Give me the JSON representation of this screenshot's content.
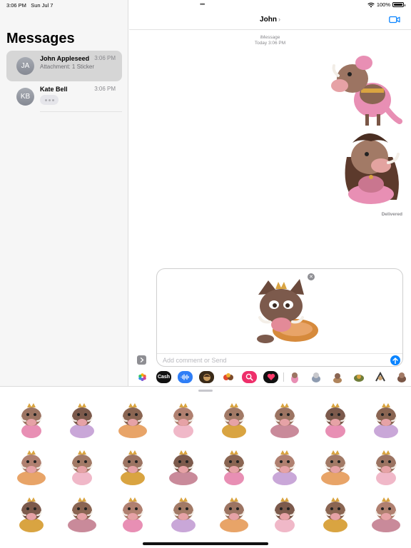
{
  "status_bar": {
    "time": "3:06 PM",
    "date": "Sun Jul 7",
    "battery": "100%"
  },
  "sidebar": {
    "title": "Messages",
    "conversations": [
      {
        "initials": "JA",
        "name": "John Appleseed",
        "time": "3:06 PM",
        "preview": "Attachment: 1 Sticker",
        "selected": true
      },
      {
        "initials": "KB",
        "name": "Kate Bell",
        "time": "3:06 PM",
        "preview": "",
        "typing": true
      }
    ]
  },
  "chat": {
    "contact_name": "John",
    "service_label": "iMessage",
    "timestamp_label": "Today 3:06 PM",
    "delivered_label": "Delivered",
    "compose_placeholder": "Add comment or Send"
  },
  "app_strip": {
    "apps": [
      {
        "name": "photos-app-icon"
      },
      {
        "name": "apple-cash-app-icon",
        "label": "Cash"
      },
      {
        "name": "audio-message-app-icon"
      },
      {
        "name": "memoji-app-icon"
      },
      {
        "name": "game-app-icon"
      },
      {
        "name": "search-images-app-icon"
      },
      {
        "name": "digital-touch-app-icon"
      }
    ]
  },
  "colors": {
    "accent": "#0a84ff",
    "sticker_pink": "#e88fb4",
    "sticker_brown": "#8a6552",
    "sticker_gold": "#d9a441"
  },
  "drawer": {
    "rows": 3,
    "columns": 8,
    "sticker_count_visible": 24
  }
}
